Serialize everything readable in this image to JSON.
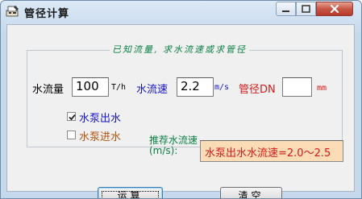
{
  "window": {
    "title": "管径计算"
  },
  "group": {
    "legend": "已知流量, 求水流速或求管径"
  },
  "flow": {
    "label": "水流量",
    "value": "100",
    "unit": "T/h"
  },
  "speed": {
    "label": "水流速",
    "value": "2.2",
    "unit": "m/s"
  },
  "diameter": {
    "label": "管径DN",
    "value": "",
    "unit": "mm"
  },
  "options": [
    {
      "label": "水泵出水",
      "checked": true
    },
    {
      "label": "水泵进水",
      "checked": false
    }
  ],
  "recommend": {
    "label": "推荐水流速(m/s):",
    "text": "水泵出水水流速=2.0～2.5"
  },
  "buttons": {
    "calc": "运算",
    "clear": "清空"
  },
  "colors": {
    "green_text": "#0a7f43",
    "blue_text": "#1414c8",
    "red_text": "#d21b1b",
    "rec_bg": "#fbdcb6"
  }
}
